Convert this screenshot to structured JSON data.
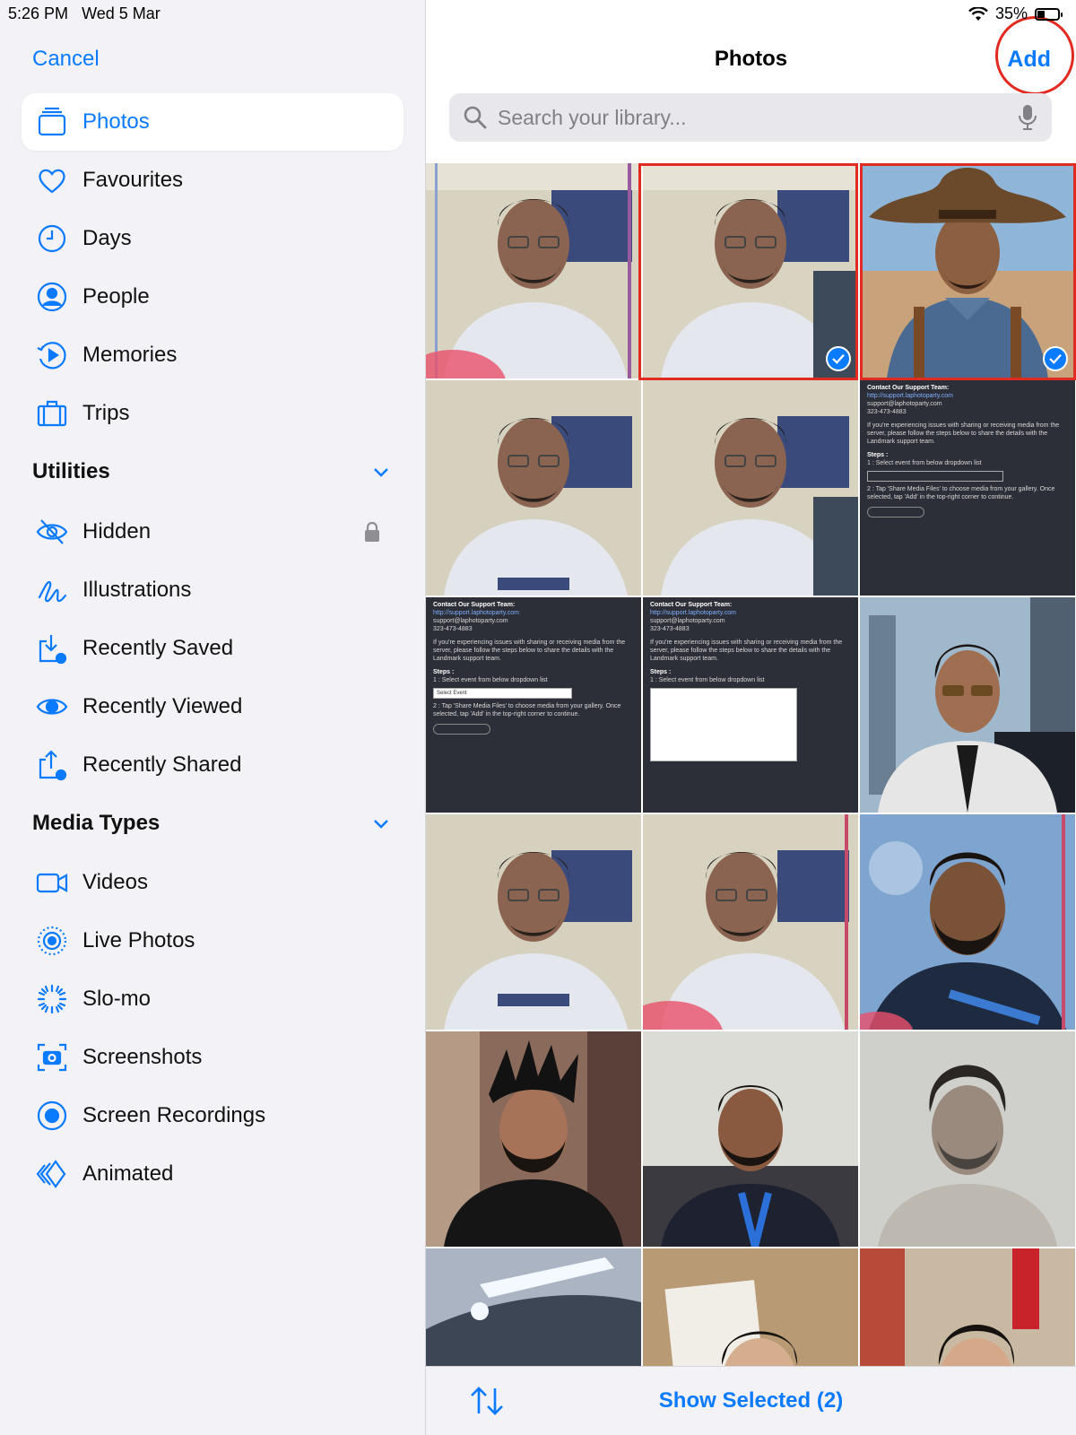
{
  "status": {
    "time": "5:26 PM",
    "date": "Wed 5 Mar",
    "battery": "35%"
  },
  "sidebar": {
    "cancel": "Cancel",
    "items": [
      {
        "label": "Photos",
        "icon": "photos-stack-icon",
        "active": true
      },
      {
        "label": "Favourites",
        "icon": "heart-icon"
      },
      {
        "label": "Days",
        "icon": "clock-icon"
      },
      {
        "label": "People",
        "icon": "person-circle-icon"
      },
      {
        "label": "Memories",
        "icon": "memories-play-icon"
      },
      {
        "label": "Trips",
        "icon": "suitcase-icon"
      }
    ],
    "utilities_title": "Utilities",
    "utilities": [
      {
        "label": "Hidden",
        "icon": "eye-slash-icon",
        "locked": true
      },
      {
        "label": "Illustrations",
        "icon": "scribble-icon"
      },
      {
        "label": "Recently Saved",
        "icon": "tray-download-icon"
      },
      {
        "label": "Recently Viewed",
        "icon": "eye-icon"
      },
      {
        "label": "Recently Shared",
        "icon": "share-clock-icon"
      }
    ],
    "media_types_title": "Media Types",
    "media_types": [
      {
        "label": "Videos",
        "icon": "video-icon"
      },
      {
        "label": "Live Photos",
        "icon": "live-photo-icon"
      },
      {
        "label": "Slo-mo",
        "icon": "slomo-icon"
      },
      {
        "label": "Screenshots",
        "icon": "screenshot-icon"
      },
      {
        "label": "Screen Recordings",
        "icon": "screen-record-icon"
      },
      {
        "label": "Animated",
        "icon": "animated-icon"
      }
    ]
  },
  "main": {
    "title": "Photos",
    "add": "Add",
    "search_placeholder": "Search your library...",
    "show_selected": "Show Selected (2)",
    "selected_count": 2
  },
  "doc_tile": {
    "heading": "Contact Our Support Team:",
    "link": "http://support.laphotoparty.com",
    "email": "support@laphotoparty.com",
    "phone": "323-473-4883",
    "para": "If you're experiencing issues with sharing or receiving media from the server, please follow the steps below to share the details with the Landmark support team.",
    "steps": "Steps :",
    "step1": "1 : Select event from below dropdown list",
    "select_event": "Select Event",
    "step2": "2 : Tap 'Share Media Files' to choose media from your gallery. Once selected, tap 'Add' in the top-right corner to continue.",
    "share_btn": "Share Media Files"
  },
  "colors": {
    "accent": "#0a7aff",
    "highlight": "#e12a20"
  }
}
